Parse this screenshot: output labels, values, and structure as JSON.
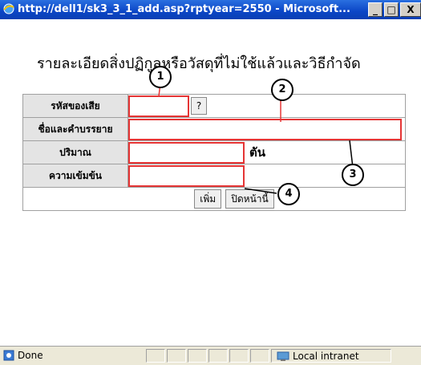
{
  "window": {
    "title": "http://dell1/sk3_3_1_add.asp?rptyear=2550 - Microsoft...",
    "min": "_",
    "max": "□",
    "close": "X"
  },
  "page": {
    "heading": "รายละเอียดสิ่งปฏิกูลหรือวัสดุที่ไม่ใช้แล้วและวิธีกำจัด",
    "fields": {
      "code_label": "รหัสของเสีย",
      "lookup_button": "?",
      "desc_label": "ชื่อและคำบรรยาย",
      "qty_label": "ปริมาณ",
      "qty_unit": "ตัน",
      "conc_label": "ความเข้มข้น"
    },
    "buttons": {
      "add": "เพิ่ม",
      "close": "ปิดหน้านี้"
    }
  },
  "annotations": [
    "1",
    "2",
    "3",
    "4"
  ],
  "status": {
    "text": "Done",
    "zone": "Local intranet"
  }
}
